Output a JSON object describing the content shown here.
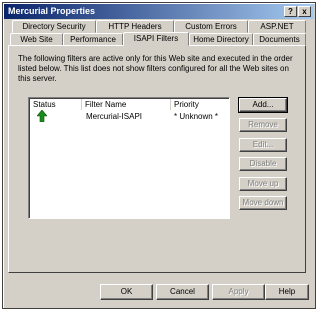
{
  "window": {
    "title": "Mercurial Properties",
    "help_glyph": "?",
    "close_glyph": "x"
  },
  "tabs_row1": [
    "Directory Security",
    "HTTP Headers",
    "Custom Errors",
    "ASP.NET"
  ],
  "tabs_row2": [
    "Web Site",
    "Performance",
    "ISAPI Filters",
    "Home Directory",
    "Documents"
  ],
  "active_tab": "ISAPI Filters",
  "description": "The following filters are active only for this Web site and executed in the order listed below. This list does not show filters configured for all the Web sites on this server.",
  "filter_list": {
    "columns": [
      "Status",
      "Filter Name",
      "Priority"
    ],
    "rows": [
      {
        "status_icon": "green-up-arrow-icon",
        "name": "Mercurial-ISAPI",
        "priority": "* Unknown *"
      }
    ]
  },
  "side_buttons": {
    "add": "Add...",
    "remove": "Remove",
    "edit": "Edit...",
    "disable": "Disable",
    "move_up": "Move up",
    "move_down": "Move down"
  },
  "footer_buttons": {
    "ok": "OK",
    "cancel": "Cancel",
    "apply": "Apply",
    "help": "Help"
  },
  "colors": {
    "title_start": "#0a246a",
    "title_end": "#a6caf0",
    "face": "#d4d0c8",
    "status_ok": "#1c8a1c"
  }
}
